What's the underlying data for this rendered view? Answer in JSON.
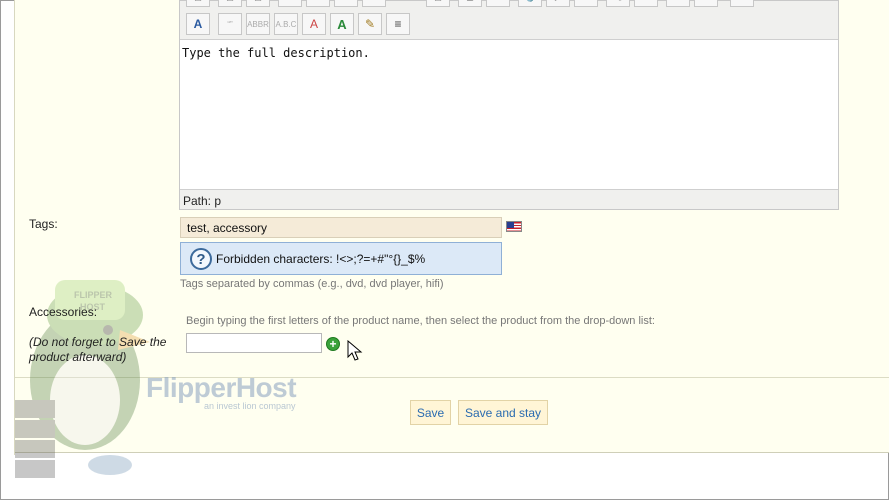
{
  "editor": {
    "content": "Type the full description.",
    "path_label": "Path: p"
  },
  "tags": {
    "label": "Tags:",
    "value": "test, accessory",
    "flag_icon": "us-flag-icon",
    "hint": "Forbidden characters: !<>;?=+#\"°{}_$%",
    "help": "Tags separated by commas (e.g., dvd, dvd player, hifi)"
  },
  "accessories": {
    "label": "Accessories:",
    "note_line1": "(Do not forget to Save the",
    "note_line2": "product afterward)",
    "instruction": "Begin typing the first letters of the product name, then select the product from the drop-down list:",
    "input_value": "",
    "add_icon": "add-icon"
  },
  "buttons": {
    "save": "Save",
    "save_and_stay": "Save and stay"
  },
  "watermark": {
    "brand": "FlipperHost",
    "tagline": "an invest lion company",
    "cap_text": "FLIPPER HOST"
  },
  "colors": {
    "panel_bg": "#fffff0",
    "tags_input_bg": "#f5ebd8",
    "hint_bg": "#dce9f7",
    "button_bg": "#fff5d6",
    "button_text": "#2a6bb0"
  }
}
